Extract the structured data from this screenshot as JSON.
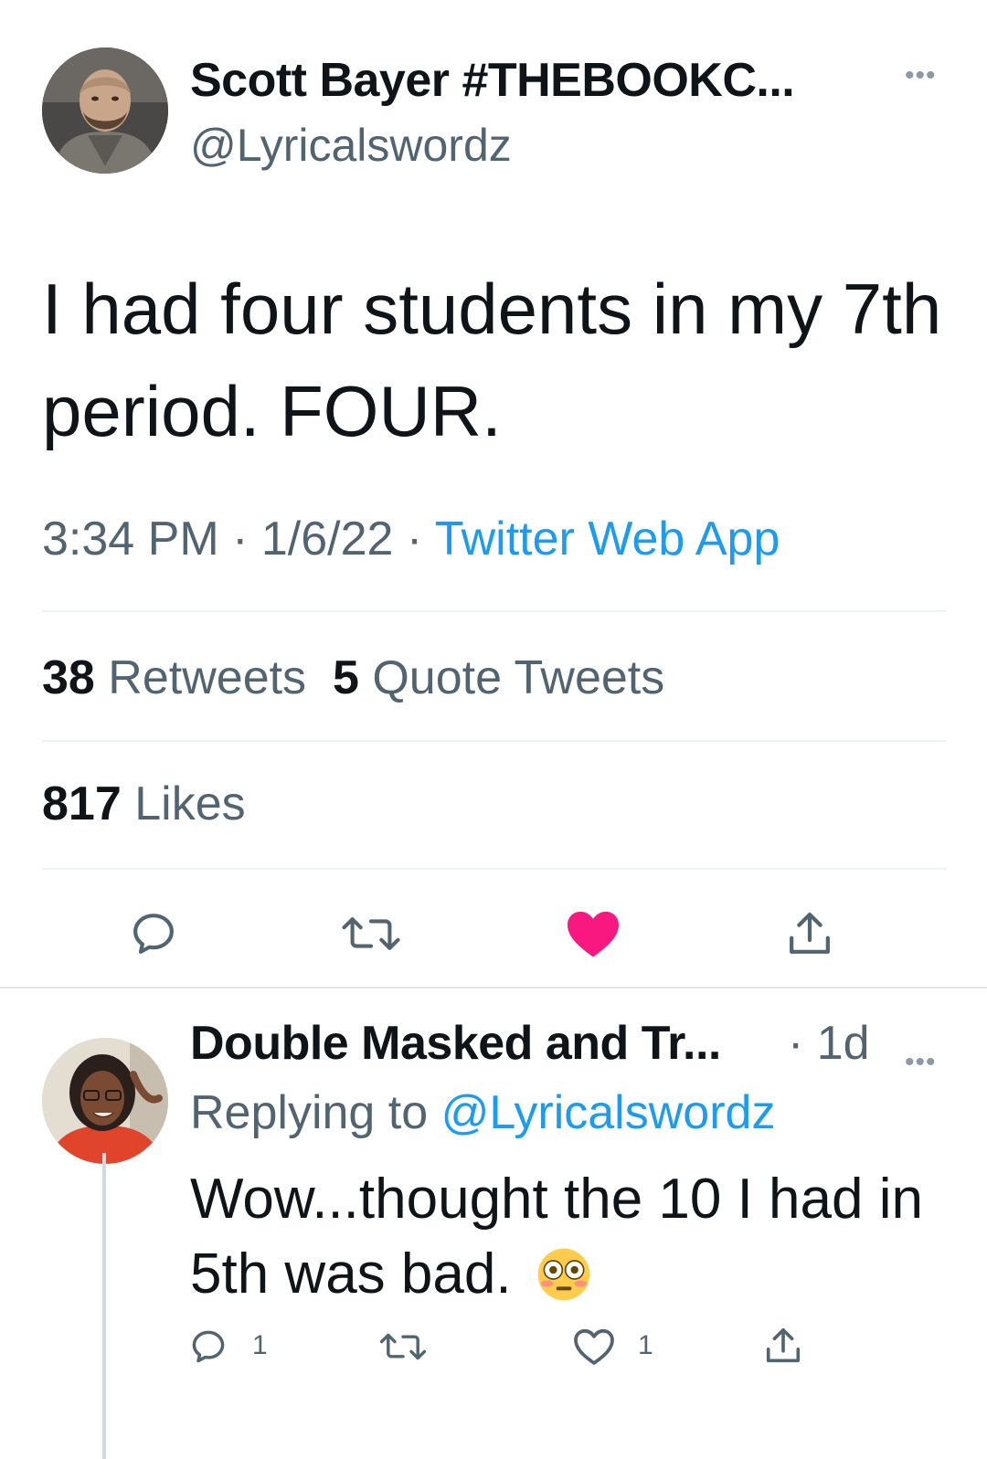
{
  "main_tweet": {
    "author": {
      "display_name": "Scott Bayer #THEBOOKC...",
      "handle": "@Lyricalswordz",
      "avatar": "avatar-photo"
    },
    "more_icon": "more-icon",
    "text": "I had four students in my 7th period. FOUR.",
    "time": "3:34 PM",
    "date": "1/6/22",
    "separator": "·",
    "source": "Twitter Web App",
    "stats": {
      "retweets_count": "38",
      "retweets_label": "Retweets",
      "quotes_count": "5",
      "quotes_label": "Quote Tweets",
      "likes_count": "817",
      "likes_label": "Likes"
    },
    "actions": [
      {
        "icon": "reply-icon"
      },
      {
        "icon": "retweet-icon"
      },
      {
        "icon": "like-icon",
        "active": true
      },
      {
        "icon": "share-icon"
      }
    ]
  },
  "reply_tweet": {
    "author": {
      "display_name": "Double Masked and Tr...",
      "avatar": "avatar-photo"
    },
    "time": "· 1d",
    "more_icon": "more-icon",
    "replying_label": "Replying to",
    "replying_handle": "@Lyricalswordz",
    "text": "Wow...thought the 10 I had in 5th was bad.",
    "emoji": "flushed-face-emoji",
    "reply_count": "1",
    "like_count": "1"
  },
  "colors": {
    "accent": "#1d9bf0",
    "like_active": "#f91880",
    "secondary_text": "#536471",
    "primary_text": "#0f1419",
    "divider": "#eff3f4"
  }
}
